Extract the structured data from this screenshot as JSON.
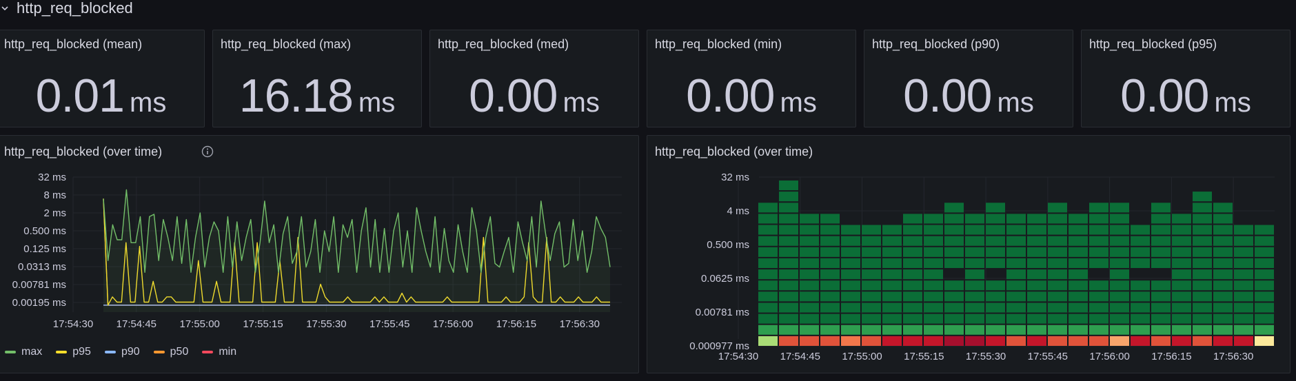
{
  "row": {
    "title": "http_req_blocked"
  },
  "stats": [
    {
      "title": "http_req_blocked (mean)",
      "value": "0.01",
      "unit": "ms"
    },
    {
      "title": "http_req_blocked (max)",
      "value": "16.18",
      "unit": "ms"
    },
    {
      "title": "http_req_blocked (med)",
      "value": "0.00",
      "unit": "ms"
    },
    {
      "title": "http_req_blocked (min)",
      "value": "0.00",
      "unit": "ms"
    },
    {
      "title": "http_req_blocked (p90)",
      "value": "0.00",
      "unit": "ms"
    },
    {
      "title": "http_req_blocked (p95)",
      "value": "0.00",
      "unit": "ms"
    }
  ],
  "timeseries": {
    "title": "http_req_blocked (over time)",
    "info_icon": "info-circle-icon"
  },
  "heatmap": {
    "title": "http_req_blocked (over time)"
  },
  "colors": {
    "max": "#73bf69",
    "p95": "#fade2a",
    "p90": "#8ab8ff",
    "p50": "#ff9830",
    "min": "#f2495c",
    "heat_dark": "#0b6e37",
    "heat_mid": "#2e9e4f"
  },
  "chart_data": [
    {
      "type": "line",
      "title": "http_req_blocked (over time)",
      "y_scale": "log2",
      "y_ticks": [
        "32 ms",
        "8 ms",
        "2 ms",
        "0.500 ms",
        "0.125 ms",
        "0.0313 ms",
        "0.00781 ms",
        "0.00195 ms"
      ],
      "y_tick_values": [
        32,
        8,
        2,
        0.5,
        0.125,
        0.0313,
        0.00781,
        0.00195
      ],
      "x_ticks": [
        "17:54:30",
        "17:54:45",
        "17:55:00",
        "17:55:15",
        "17:55:30",
        "17:55:45",
        "17:56:00",
        "17:56:15",
        "17:56:30"
      ],
      "x_range": [
        "17:54:30",
        "17:56:40"
      ],
      "grid": true,
      "legend": "bottom",
      "series": [
        {
          "name": "max",
          "values": [
            6,
            0.05,
            0.8,
            0.25,
            0.25,
            12,
            0.2,
            0.2,
            1.5,
            0.02,
            1.5,
            1.8,
            0.05,
            1.2,
            0.3,
            0.05,
            1.5,
            0.04,
            1.2,
            0.02,
            0.3,
            2,
            0.03,
            0.3,
            1,
            0.5,
            0.02,
            1.5,
            0.03,
            1,
            0.05,
            0.3,
            1.2,
            0.02,
            0.2,
            5,
            0.2,
            0.8,
            0.02,
            0.4,
            1.5,
            0.04,
            0.1,
            1.5,
            0.03,
            0.1,
            1.2,
            0.02,
            0.5,
            0.1,
            1.5,
            0.02,
            0.8,
            0.3,
            1.2,
            0.02,
            0.5,
            3,
            0.03,
            1.2,
            0.02,
            0.6,
            0.02,
            0.5,
            2,
            0.03,
            0.5,
            0.02,
            3,
            0.5,
            0.1,
            0.03,
            1.5,
            0.02,
            0.6,
            0.05,
            0.02,
            0.8,
            0.1,
            0.02,
            3,
            0.5,
            0.02,
            0.3,
            1.5,
            0.04,
            0.03,
            0.1,
            0.3,
            0.02,
            1,
            0.2,
            0.05,
            1.5,
            0.03,
            5,
            0.4,
            0.05,
            0.4,
            1,
            0.03,
            0.04,
            1.2,
            0.05,
            0.5,
            0.02,
            0.1,
            1.5,
            0.6,
            0.3,
            0.03
          ]
        },
        {
          "name": "p95",
          "values": [
            6,
            0.0015,
            0.003,
            0.002,
            0.002,
            0.2,
            0.002,
            0.002,
            0.15,
            0.002,
            0.002,
            0.01,
            0.002,
            0.002,
            0.003,
            0.003,
            0.002,
            0.002,
            0.002,
            0.002,
            0.002,
            0.05,
            0.002,
            0.002,
            0.002,
            0.01,
            0.002,
            0.002,
            0.002,
            0.2,
            0.002,
            0.002,
            0.002,
            0.002,
            0.2,
            0.002,
            0.002,
            0.002,
            0.002,
            0.05,
            0.002,
            0.002,
            0.002,
            0.3,
            0.002,
            0.002,
            0.002,
            0.002,
            0.008,
            0.003,
            0.002,
            0.002,
            0.002,
            0.002,
            0.003,
            0.002,
            0.002,
            0.002,
            0.002,
            0.002,
            0.003,
            0.002,
            0.003,
            0.002,
            0.002,
            0.002,
            0.004,
            0.002,
            0.003,
            0.002,
            0.002,
            0.002,
            0.002,
            0.002,
            0.002,
            0.002,
            0.003,
            0.002,
            0.002,
            0.002,
            0.002,
            0.002,
            0.002,
            0.002,
            0.3,
            0.002,
            0.002,
            0.002,
            0.002,
            0.003,
            0.002,
            0.002,
            0.002,
            0.003,
            0.2,
            0.003,
            0.002,
            0.002,
            0.3,
            0.002,
            0.002,
            0.003,
            0.002,
            0.002,
            0.002,
            0.003,
            0.002,
            0.002,
            0.002,
            0.003,
            0.002,
            0.002,
            0.002
          ]
        },
        {
          "name": "p90",
          "values": [
            0.0015,
            0.0015,
            0.0015,
            0.0015,
            0.0015,
            0.0015,
            0.0015,
            0.0015,
            0.0015,
            0.0015,
            0.0015,
            0.0015,
            0.0015,
            0.0015,
            0.0015,
            0.0015,
            0.0015,
            0.0015,
            0.0015,
            0.0015,
            0.0015,
            0.0015,
            0.0015,
            0.0015,
            0.0015,
            0.0015,
            0.0015,
            0.0015,
            0.0015,
            0.0015,
            0.0015,
            0.0015,
            0.0015,
            0.0015,
            0.0015,
            0.0015,
            0.0015,
            0.0015,
            0.0015,
            0.0015,
            0.0015,
            0.0015,
            0.0015,
            0.0015,
            0.0015,
            0.0015,
            0.0015,
            0.0015,
            0.0015,
            0.0015,
            0.0015,
            0.0015,
            0.0015,
            0.0015,
            0.0015,
            0.0015,
            0.0015,
            0.0015,
            0.0015,
            0.0015,
            0.0015,
            0.0015,
            0.0015,
            0.0015,
            0.0015,
            0.0015,
            0.0015,
            0.0015,
            0.0015,
            0.0015,
            0.0015,
            0.0015,
            0.0015,
            0.0015,
            0.0015,
            0.0015,
            0.0015,
            0.0015,
            0.0015,
            0.0015,
            0.0015,
            0.0015,
            0.0015,
            0.0015,
            0.0015,
            0.0015,
            0.0015,
            0.0015,
            0.0015,
            0.0015,
            0.0015,
            0.0015,
            0.0015,
            0.0015,
            0.0015,
            0.0015,
            0.0015,
            0.0015,
            0.0015,
            0.0015,
            0.0015,
            0.0015,
            0.0015,
            0.0015,
            0.0015,
            0.0015,
            0.0015,
            0.0015,
            0.0015,
            0.0015,
            0.0015,
            0.0015,
            0.0015
          ]
        },
        {
          "name": "p50",
          "values": [
            6,
            0.001,
            0.001,
            0.001,
            0.001,
            0.001,
            0.001,
            0.001,
            0.001,
            0.001,
            0.001,
            0.001,
            0.001,
            0.001,
            0.001,
            0.001,
            0.001,
            0.001,
            0.001,
            0.001,
            0.001,
            0.001,
            0.001,
            0.001,
            0.001,
            0.001,
            0.001,
            0.001,
            0.001,
            0.001,
            0.001,
            0.001,
            0.001,
            0.001,
            0.001,
            0.001,
            0.001,
            0.001,
            0.001,
            0.001,
            0.001,
            0.001,
            0.001,
            0.001,
            0.001,
            0.001,
            0.001,
            0.001,
            0.001,
            0.001,
            0.001,
            0.001,
            0.001,
            0.001,
            0.001,
            0.001,
            0.001,
            0.001,
            0.001,
            0.001,
            0.001,
            0.001,
            0.001,
            0.001,
            0.001,
            0.001,
            0.001,
            0.001,
            0.001,
            0.001,
            0.001,
            0.001,
            0.001,
            0.001,
            0.001,
            0.001,
            0.001,
            0.001,
            0.001,
            0.001,
            0.001,
            0.001,
            0.001,
            0.001,
            0.001,
            0.001,
            0.001,
            0.001,
            0.001,
            0.001,
            0.001,
            0.001,
            0.001,
            0.001,
            0.001,
            0.001,
            0.001,
            0.001,
            0.001,
            0.001,
            0.001,
            0.001,
            0.001,
            0.001,
            0.001,
            0.001,
            0.001,
            0.001,
            0.001,
            0.001,
            0.001,
            0.001,
            0.001
          ]
        },
        {
          "name": "min",
          "values": [
            0.001,
            0.001,
            0.001,
            0.001,
            0.001,
            0.001,
            0.001,
            0.001,
            0.001,
            0.001,
            0.001,
            0.001,
            0.001,
            0.001,
            0.001,
            0.001,
            0.001,
            0.001,
            0.001,
            0.001,
            0.001,
            0.001,
            0.001,
            0.001,
            0.001,
            0.001,
            0.001,
            0.001,
            0.001,
            0.001,
            0.001,
            0.001,
            0.001,
            0.001,
            0.001,
            0.001,
            0.001,
            0.001,
            0.001,
            0.001,
            0.001,
            0.001,
            0.001,
            0.001,
            0.001,
            0.001,
            0.001,
            0.001,
            0.001,
            0.001,
            0.001,
            0.001,
            0.001,
            0.001,
            0.001,
            0.001,
            0.001,
            0.001,
            0.001,
            0.001,
            0.001,
            0.001,
            0.001,
            0.001,
            0.001,
            0.001,
            0.001,
            0.001,
            0.001,
            0.001,
            0.001,
            0.001,
            0.001,
            0.001,
            0.001,
            0.001,
            0.001,
            0.001,
            0.001,
            0.001,
            0.001,
            0.001,
            0.001,
            0.001,
            0.001,
            0.001,
            0.001,
            0.001,
            0.001,
            0.001,
            0.001,
            0.001,
            0.001,
            0.001,
            0.001,
            0.001,
            0.001,
            0.001,
            0.001,
            0.001,
            0.001,
            0.001,
            0.001,
            0.001,
            0.001,
            0.001,
            0.001,
            0.001,
            0.001,
            0.001,
            0.001,
            0.001,
            0.001
          ]
        }
      ]
    },
    {
      "type": "heatmap",
      "title": "http_req_blocked (over time)",
      "y_scale": "log2",
      "y_ticks": [
        "32 ms",
        "4 ms",
        "0.500 ms",
        "0.0625 ms",
        "0.00781 ms",
        "0.000977 ms"
      ],
      "y_tick_values": [
        32,
        4,
        0.5,
        0.0625,
        0.00781,
        0.000977
      ],
      "x_ticks": [
        "17:54:30",
        "17:54:45",
        "17:55:00",
        "17:55:15",
        "17:55:30",
        "17:55:45",
        "17:56:00",
        "17:56:15",
        "17:56:30"
      ],
      "x_range": [
        "17:54:30",
        "17:56:40"
      ],
      "columns": 25,
      "rows": 15,
      "column_top_bucket": [
        12,
        14,
        11,
        11,
        10,
        10,
        10,
        11,
        11,
        12,
        11,
        12,
        11,
        11,
        12,
        11,
        12,
        12,
        10,
        12,
        11,
        13,
        12,
        10,
        10
      ],
      "gap_buckets": [
        [],
        [],
        [],
        [],
        [],
        [],
        [],
        [],
        [],
        [
          6
        ],
        [],
        [
          6
        ],
        [],
        [],
        [],
        [],
        [
          6
        ],
        [],
        [
          6
        ],
        [
          6
        ],
        [],
        [],
        [],
        [],
        []
      ],
      "base_row_colors": [
        "#a9dc76",
        "#e0533a",
        "#e0533a",
        "#e0533a",
        "#f2774b",
        "#e0533a",
        "#c4162a",
        "#c4162a",
        "#c4162a",
        "#a50f2d",
        "#a50f2d",
        "#c4162a",
        "#e0533a",
        "#c4162a",
        "#e0533a",
        "#e0533a",
        "#e0533a",
        "#f7a46b",
        "#c4162a",
        "#e0533a",
        "#c4162a",
        "#e0533a",
        "#c4162a",
        "#c4162a",
        "#fbe99b"
      ]
    }
  ]
}
